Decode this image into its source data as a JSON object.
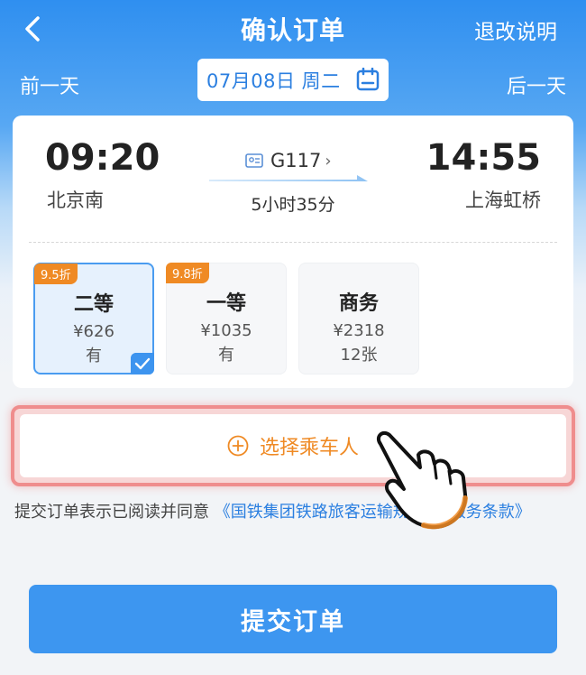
{
  "header": {
    "title": "确认订单",
    "refund_label": "退改说明",
    "prev_day": "前一天",
    "next_day": "后一天",
    "date": "07月08日 周二"
  },
  "trip": {
    "departure_time": "09:20",
    "departure_station": "北京南",
    "arrival_time": "14:55",
    "arrival_station": "上海虹桥",
    "train_no": "G117",
    "duration": "5小时35分"
  },
  "seats": [
    {
      "name": "二等",
      "price": "¥626",
      "availability": "有",
      "discount": "9.5折",
      "selected": true
    },
    {
      "name": "一等",
      "price": "¥1035",
      "availability": "有",
      "discount": "9.8折",
      "selected": false
    },
    {
      "name": "商务",
      "price": "¥2318",
      "availability": "12张",
      "discount": "",
      "selected": false
    }
  ],
  "passenger": {
    "label": "选择乘车人"
  },
  "agreement": {
    "text": "提交订单表示已阅读并同意",
    "link1": "《国铁集团铁路旅客运输规程》",
    "link2": "《服务条款》"
  },
  "submit_label": "提交订单",
  "colors": {
    "brand_blue": "#3d96f0",
    "accent_orange": "#ef8a24",
    "highlight_red": "#ef8d8d"
  }
}
